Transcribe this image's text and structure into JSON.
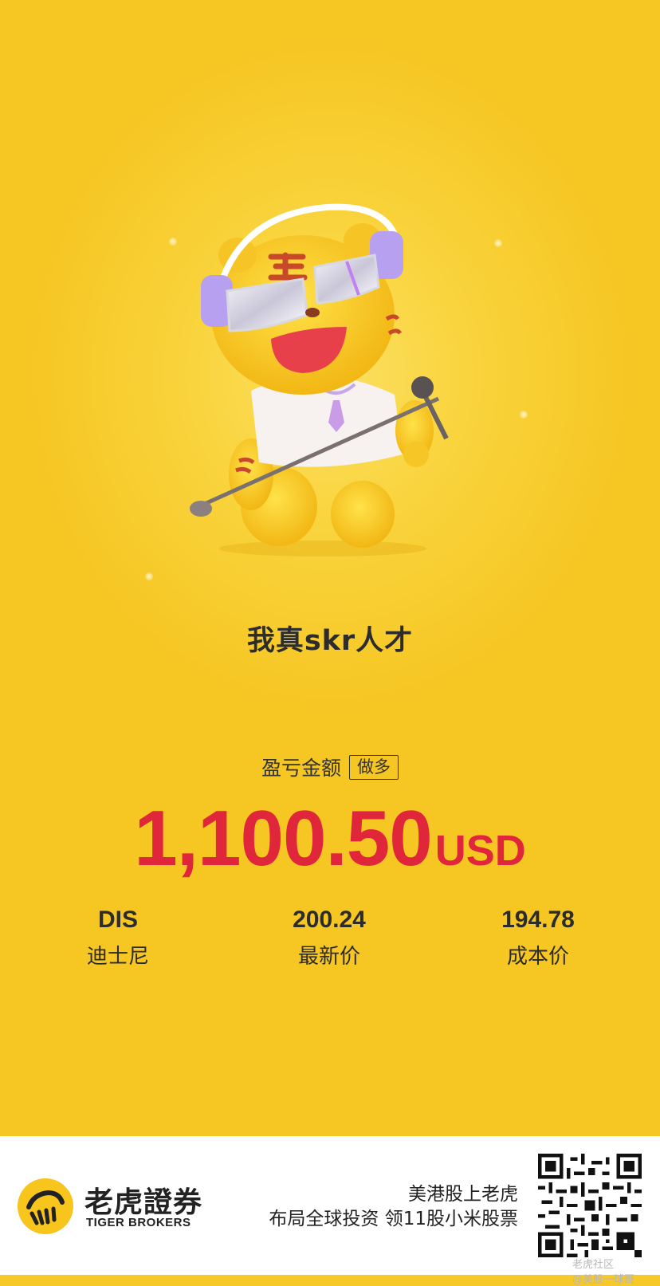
{
  "caption": "我真skr人才",
  "pnl": {
    "label": "盈亏金额",
    "tag": "做多",
    "amount": "1,100.50",
    "currency": "USD"
  },
  "stats": [
    {
      "value": "DIS",
      "label": "迪士尼"
    },
    {
      "value": "200.24",
      "label": "最新价"
    },
    {
      "value": "194.78",
      "label": "成本价"
    }
  ],
  "footer": {
    "brand_cn": "老虎證券",
    "brand_en": "TIGER BROKERS",
    "slogan_line1": "美港股上老虎",
    "slogan_line2": "布局全球投资 领11股小米股票",
    "watermark_line1": "老虎社区",
    "watermark_line2": "@美股一球哥"
  },
  "colors": {
    "background": "#f7c928",
    "amount": "#e0263a",
    "text": "#2c2c2c",
    "logo_yellow": "#f8c51d"
  },
  "icons": {
    "mascot": "tiger-mascot-headphones-microphone",
    "logo": "tiger-stripes-logo-icon",
    "qr": "qr-code-icon"
  }
}
